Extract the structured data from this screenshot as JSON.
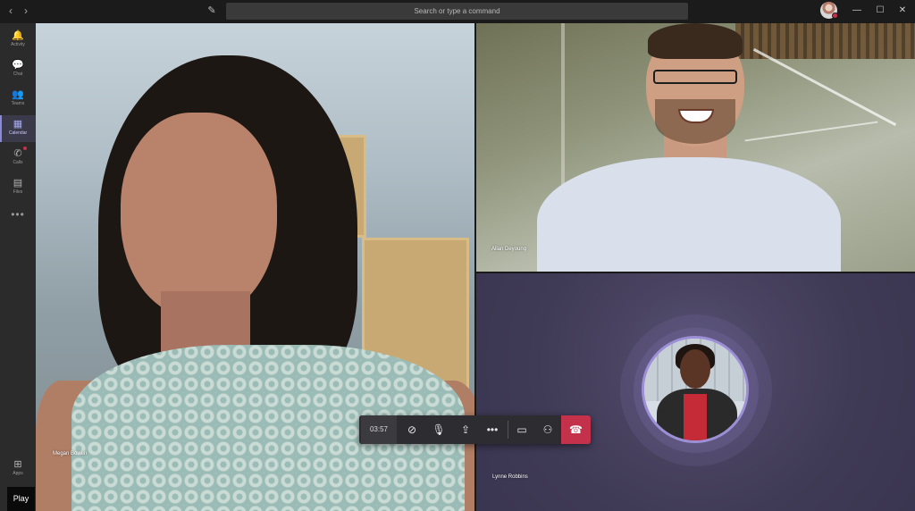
{
  "titlebar": {
    "back_icon": "‹",
    "forward_icon": "›",
    "compose_icon": "✎",
    "search_placeholder": "Search or type a command",
    "minimize_icon": "—",
    "maximize_icon": "☐",
    "close_icon": "✕"
  },
  "rail": {
    "items": [
      {
        "label": "Activity",
        "icon": "🔔"
      },
      {
        "label": "Chat",
        "icon": "💬"
      },
      {
        "label": "Teams",
        "icon": "👥"
      },
      {
        "label": "Calendar",
        "icon": "▦"
      },
      {
        "label": "Calls",
        "icon": "✆"
      },
      {
        "label": "Files",
        "icon": "▤"
      }
    ],
    "more": "•••",
    "apps": {
      "label": "Apps",
      "icon": "⊞"
    }
  },
  "participants": {
    "megan": {
      "name": "Megan Bowen"
    },
    "allan": {
      "name": "Allan Deyoung"
    },
    "lynne": {
      "name": "Lynne Robbins"
    }
  },
  "call_controls": {
    "timer": "03:57",
    "video_icon": "⊘",
    "mic_icon": "🎙",
    "share_icon": "⇪",
    "more_icon": "•••",
    "chat_icon": "▭",
    "people_icon": "⚇",
    "hangup_icon": "☎"
  },
  "overlay": {
    "play_label": "Play"
  },
  "colors": {
    "accent": "#8b8cd9",
    "hangup": "#c4314b",
    "rail_bg": "#2b2b2b",
    "titlebar_bg": "#1b1b1b"
  }
}
